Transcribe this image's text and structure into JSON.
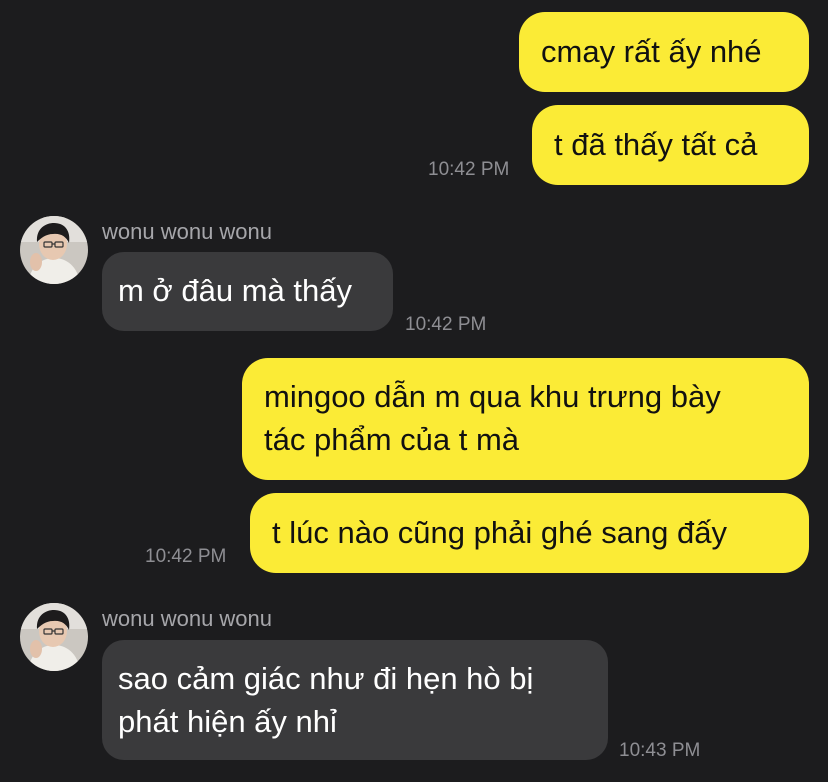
{
  "messages": [
    {
      "text": "cmay rất ấy nhé"
    },
    {
      "text": "t đã thấy tất cả",
      "time": "10:42 PM"
    },
    {
      "sender": "wonu wonu wonu",
      "text": "m ở đâu mà thấy",
      "time": "10:42 PM"
    },
    {
      "lines": [
        "mingoo dẫn m qua khu trưng bày",
        "tác phẩm của t mà"
      ]
    },
    {
      "text": "t lúc nào cũng phải ghé sang đấy",
      "time": "10:42 PM"
    },
    {
      "sender": "wonu wonu wonu",
      "lines": [
        "sao cảm giác như đi hẹn hò bị",
        "phát hiện ấy nhỉ"
      ],
      "time": "10:43 PM"
    }
  ],
  "colors": {
    "background": "#1c1c1e",
    "outgoing_bubble": "#fbeb36",
    "incoming_bubble": "#3a3a3c",
    "timestamp": "#8e8e93",
    "sender_name": "#a6a6aa"
  }
}
